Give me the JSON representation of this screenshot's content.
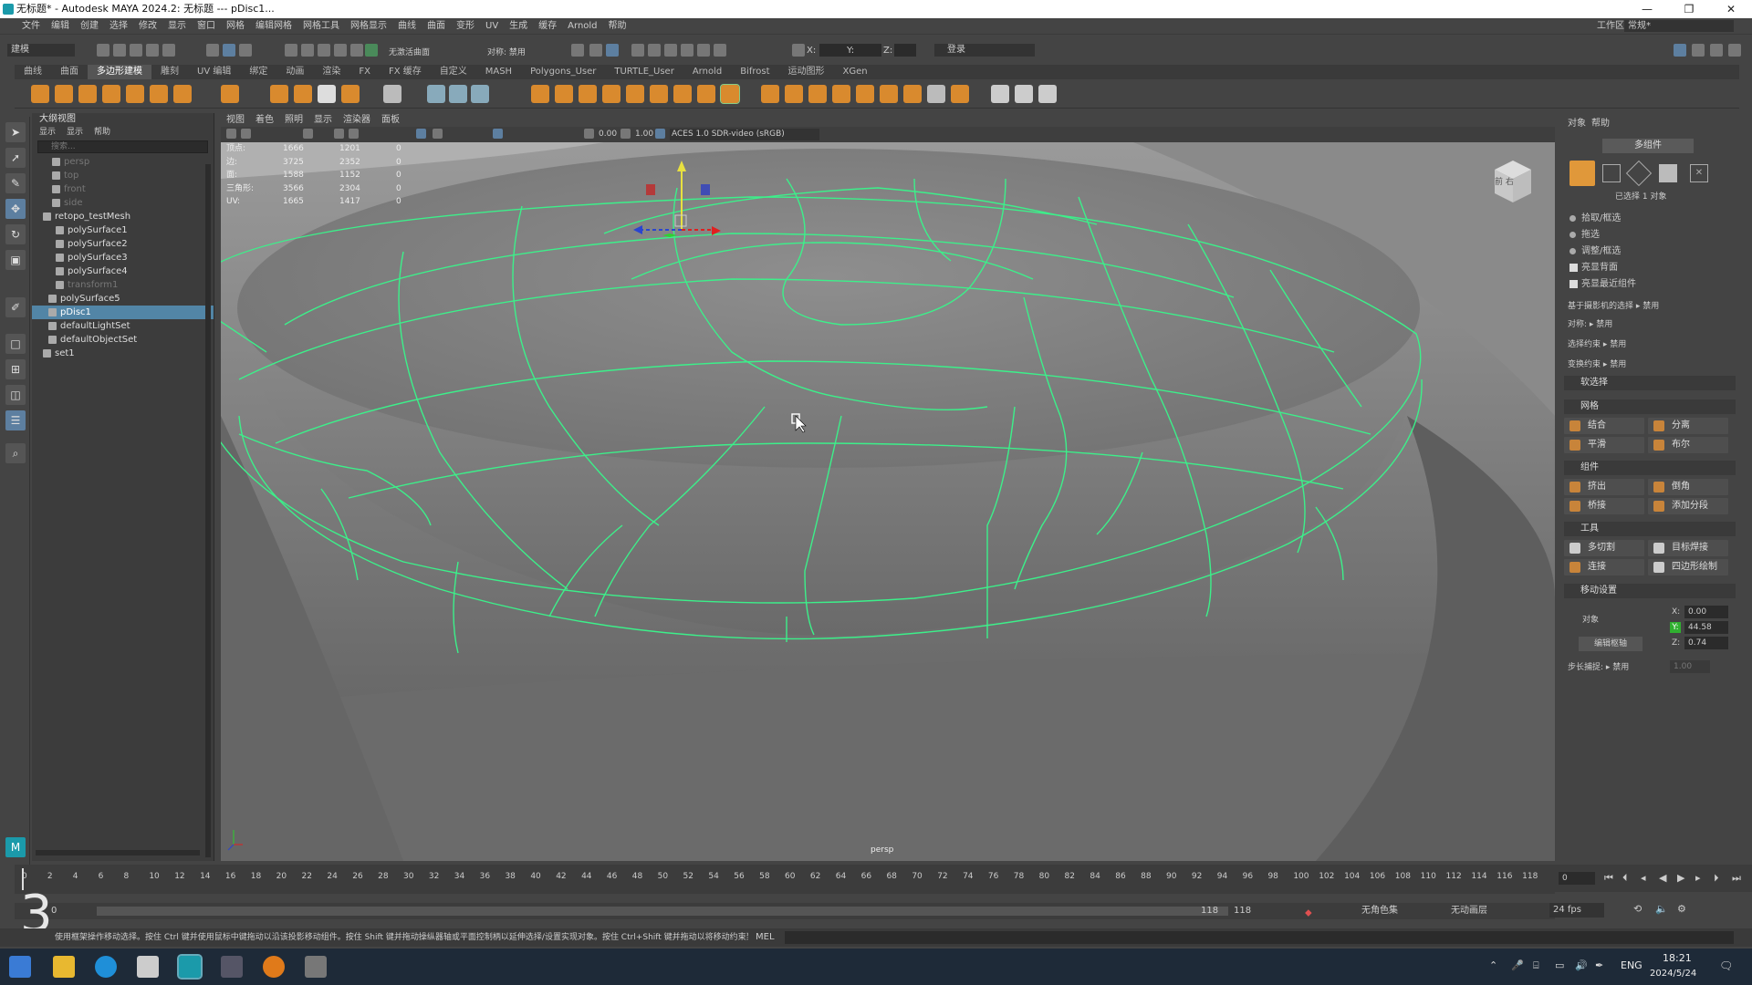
{
  "titlebar": {
    "title": "无标题* - Autodesk MAYA 2024.2: 无标题   ---   pDisc1..."
  },
  "menubar": {
    "items": [
      "文件",
      "编辑",
      "创建",
      "选择",
      "修改",
      "显示",
      "窗口",
      "网格",
      "编辑网格",
      "网格工具",
      "网格显示",
      "曲线",
      "曲面",
      "变形",
      "UV",
      "生成",
      "缓存",
      "Arnold",
      "帮助"
    ],
    "workspace_label": "工作区:",
    "workspace_value": "常规*"
  },
  "statusline": {
    "mode": "建模",
    "live_surface": "无激活曲面",
    "symmetry": "对称: 禁用",
    "login": "登录",
    "x_label": "X:",
    "y_label": "Y:",
    "z_label": "Z:"
  },
  "shelf_tabs": [
    "曲线",
    "曲面",
    "多边形建模",
    "雕刻",
    "UV 编辑",
    "绑定",
    "动画",
    "渲染",
    "FX",
    "FX 缓存",
    "自定义",
    "MASH",
    "Polygons_User",
    "TURTLE_User",
    "Arnold",
    "Bifrost",
    "运动图形",
    "XGen"
  ],
  "shelf_active": "多边形建模",
  "outliner": {
    "title": "大纲视图",
    "menu": [
      "显示",
      "显示",
      "帮助"
    ],
    "search_placeholder": "搜索...",
    "items": [
      {
        "label": "persp",
        "dim": true
      },
      {
        "label": "top",
        "dim": true
      },
      {
        "label": "front",
        "dim": true
      },
      {
        "label": "side",
        "dim": true
      },
      {
        "label": "retopo_testMesh",
        "dim": false
      },
      {
        "label": "polySurface1",
        "dim": false
      },
      {
        "label": "polySurface2",
        "dim": false
      },
      {
        "label": "polySurface3",
        "dim": false
      },
      {
        "label": "polySurface4",
        "dim": false
      },
      {
        "label": "transform1",
        "dim": true
      },
      {
        "label": "polySurface5",
        "dim": false
      },
      {
        "label": "pDisc1",
        "dim": false,
        "selected": true
      },
      {
        "label": "defaultLightSet",
        "dim": false
      },
      {
        "label": "defaultObjectSet",
        "dim": false
      },
      {
        "label": "set1",
        "dim": false
      }
    ]
  },
  "viewport": {
    "menu": [
      "视图",
      "着色",
      "照明",
      "显示",
      "渲染器",
      "面板"
    ],
    "exposure": "0.00",
    "gamma": "1.00",
    "color_space": "ACES 1.0 SDR-video (sRGB)",
    "camera_label": "persp",
    "hud": [
      {
        "k": "顶点:",
        "a": "1666",
        "b": "1201",
        "c": "0"
      },
      {
        "k": "边:",
        "a": "3725",
        "b": "2352",
        "c": "0"
      },
      {
        "k": "面:",
        "a": "1588",
        "b": "1152",
        "c": "0"
      },
      {
        "k": "三角形:",
        "a": "3566",
        "b": "2304",
        "c": "0"
      },
      {
        "k": "UV:",
        "a": "1665",
        "b": "1417",
        "c": "0"
      }
    ],
    "viewcube": "前  右"
  },
  "rightpanel": {
    "tabs": [
      "对象",
      "帮助"
    ],
    "mode_label": "多组件",
    "selected_count": "已选择 1 对象",
    "options": [
      "拾取/框选",
      "拖选",
      "调整/框选"
    ],
    "checks": [
      "亮显背面",
      "亮显最近组件"
    ],
    "camera_sel": "基于摄影机的选择 ▸  禁用",
    "symmetry": "对称: ▸  禁用",
    "sel_constraint": "选择约束 ▸  禁用",
    "xform_constraint": "变换约束 ▸  禁用",
    "soft_select": "软选择",
    "sections": {
      "mesh": "网格",
      "components": "组件",
      "tools": "工具",
      "move": "移动设置"
    },
    "mesh_buttons": [
      "结合",
      "分离",
      "平滑",
      "布尔"
    ],
    "comp_buttons": [
      "挤出",
      "倒角",
      "桥接",
      "添加分段"
    ],
    "tool_buttons": [
      "多切割",
      "目标焊接",
      "连接",
      "四边形绘制"
    ],
    "move": {
      "space": "对象",
      "edit_pivot": "编辑枢轴",
      "step_snap": "步长捕捉: ▸  禁用",
      "x": "0.00",
      "y": "44.58",
      "z": "0.74",
      "step": "1.00"
    }
  },
  "timeline": {
    "ticks": [
      "0",
      "2",
      "4",
      "6",
      "8",
      "10",
      "12",
      "14",
      "16",
      "18",
      "20",
      "22",
      "24",
      "26",
      "28",
      "30",
      "32",
      "34",
      "36",
      "38",
      "40",
      "42",
      "44",
      "46",
      "48",
      "50",
      "52",
      "54",
      "56",
      "58",
      "60",
      "62",
      "64",
      "66",
      "68",
      "70",
      "72",
      "74",
      "76",
      "78",
      "80",
      "82",
      "84",
      "86",
      "88",
      "90",
      "92",
      "94",
      "96",
      "98",
      "100",
      "102",
      "104",
      "106",
      "108",
      "110",
      "112",
      "114",
      "116",
      "118"
    ],
    "current_frame": "0",
    "range_start": "0",
    "range_end": "118",
    "range_end2": "118",
    "charset": "无角色集",
    "anim_layer": "无动画层",
    "fps": "24 fps",
    "big_frame": "3"
  },
  "cmdline": {
    "help": "使用框架操作移动选择。按住 Ctrl 键并使用鼠标中键拖动以沿该投影移动组件。按住 Shift 键并拖动操纵器轴或平面控制柄以延伸选择/设置实现对象。按住 Ctrl+Shift 键并拖动以将移动约束到边上。按住 D 键 ins",
    "lang": "MEL"
  },
  "taskbar": {
    "time": "18:21",
    "date": "2024/5/24",
    "lang": "ENG"
  }
}
